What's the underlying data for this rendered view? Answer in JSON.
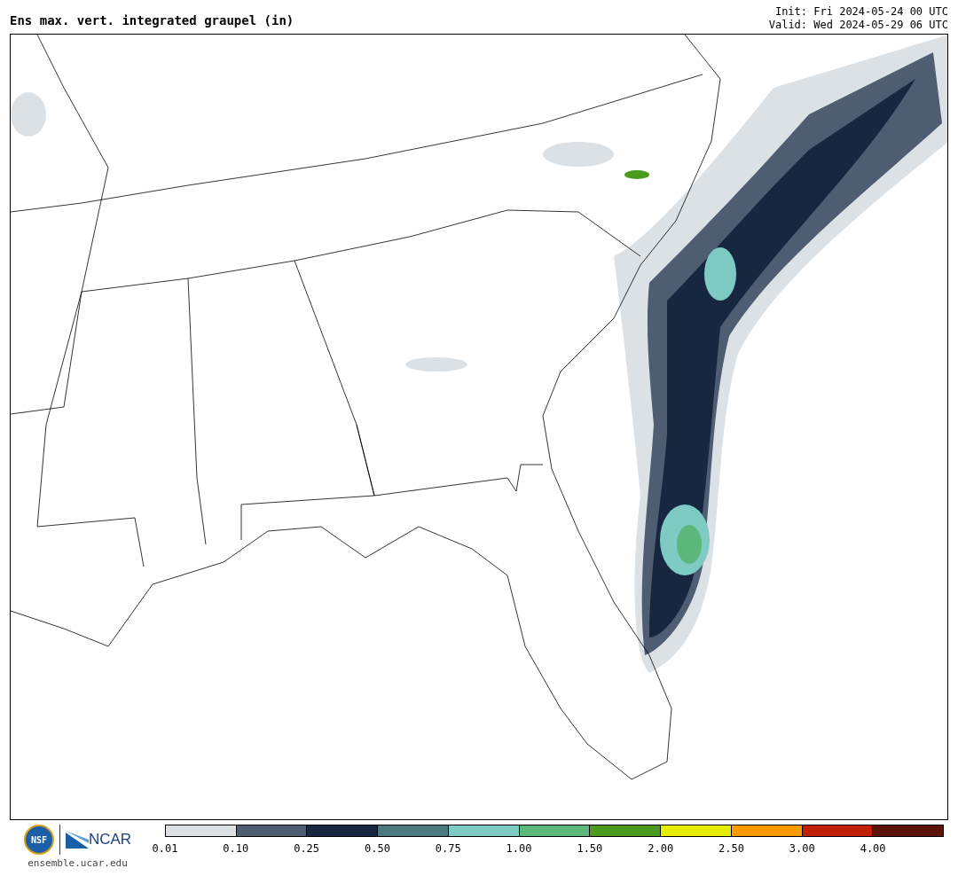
{
  "title": "Ens max. vert. integrated graupel (in)",
  "init": "Init: Fri 2024-05-24 00 UTC",
  "valid": "Valid: Wed 2024-05-29 06 UTC",
  "logos": {
    "nsf": "NSF",
    "ncar": "NCAR",
    "url": "ensemble.ucar.edu"
  },
  "colorbar": [
    {
      "label": "0.01",
      "color": "#dce1e5"
    },
    {
      "label": "0.10",
      "color": "#4f5d73"
    },
    {
      "label": "0.25",
      "color": "#172740"
    },
    {
      "label": "0.50",
      "color": "#4a7a80"
    },
    {
      "label": "0.75",
      "color": "#7ecbc4"
    },
    {
      "label": "1.00",
      "color": "#5cb87a"
    },
    {
      "label": "1.50",
      "color": "#4a9a1e"
    },
    {
      "label": "2.00",
      "color": "#e6ee00"
    },
    {
      "label": "2.50",
      "color": "#ff9a00"
    },
    {
      "label": "3.00",
      "color": "#c02000"
    },
    {
      "label": "4.00",
      "color": "#5c1408"
    }
  ]
}
